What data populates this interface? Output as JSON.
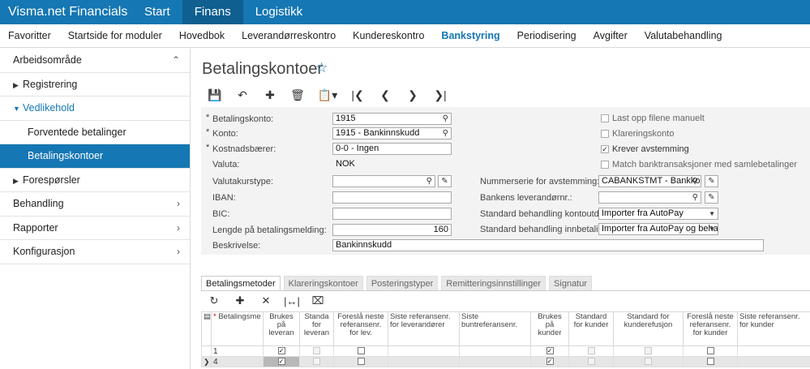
{
  "app": {
    "title": "Visma.net Financials"
  },
  "topnav": [
    {
      "label": "Start"
    },
    {
      "label": "Finans"
    },
    {
      "label": "Logistikk"
    }
  ],
  "subnav": [
    {
      "label": "Favoritter"
    },
    {
      "label": "Startside for moduler"
    },
    {
      "label": "Hovedbok"
    },
    {
      "label": "Leverandørreskontro"
    },
    {
      "label": "Kundereskontro"
    },
    {
      "label": "Bankstyring"
    },
    {
      "label": "Periodisering"
    },
    {
      "label": "Avgifter"
    },
    {
      "label": "Valutabehandling"
    }
  ],
  "sidebar": {
    "workspace": "Arbeidsområde",
    "registrering": "Registrering",
    "vedlikehold": "Vedlikehold",
    "forventede": "Forventede betalinger",
    "betalingskontoer": "Betalingskontoer",
    "forespørsler": "Forespørsler",
    "behandling": "Behandling",
    "rapporter": "Rapporter",
    "konfigurasjon": "Konfigurasjon"
  },
  "page": {
    "title": "Betalingskontoer"
  },
  "form": {
    "betalingskonto_label": "Betalingskonto:",
    "betalingskonto_value": "1915",
    "konto_label": "Konto:",
    "konto_value": "1915 - Bankinnskudd",
    "kostnadsbaerer_label": "Kostnadsbærer:",
    "kostnadsbaerer_value": "0-0 - Ingen",
    "valuta_label": "Valuta:",
    "valuta_value": "NOK",
    "valutakurstype_label": "Valutakurstype:",
    "iban_label": "IBAN:",
    "bic_label": "BIC:",
    "lengde_label": "Lengde på betalingsmelding:",
    "lengde_value": "160",
    "beskrivelse_label": "Beskrivelse:",
    "beskrivelse_value": "Bankinnskudd",
    "last_opp_label": "Last opp filene manuelt",
    "klarering_label": "Klareringskonto",
    "krever_label": "Krever avstemming",
    "match_label": "Match banktransaksjoner med samlebetalinger",
    "nummerserie_label": "Nummerserie for avstemming:",
    "nummerserie_value": "CABANKSTMT - Bankkontc",
    "bankens_label": "Bankens leverandørnr.:",
    "std_kontoutdrag_label": "Standard behandling kontoutdrag:",
    "std_kontoutdrag_value": "Importer fra AutoPay",
    "std_innbetalinger_label": "Standard behandling innbetalinger:",
    "std_innbetalinger_value": "Importer fra AutoPay og behandle"
  },
  "tabs": [
    {
      "label": "Betalingsmetoder"
    },
    {
      "label": "Klareringskontoer"
    },
    {
      "label": "Posteringstyper"
    },
    {
      "label": "Remitteringsinnstillinger"
    },
    {
      "label": "Signatur"
    }
  ],
  "grid": {
    "headers": [
      "Betalingsme",
      "Brukes på leveran",
      "Standa for leveran",
      "Foreslå neste referansenr. for lev.",
      "Siste referansenr. for leverandører",
      "Siste buntreferansenr.",
      "Brukes på kunder",
      "Standard for kunder",
      "Standard for kunderefusjon",
      "Foreslå neste referansenr. for kunder",
      "Siste referansenr. for kunder"
    ],
    "rows": [
      {
        "id": "1"
      },
      {
        "id": "4"
      }
    ]
  }
}
